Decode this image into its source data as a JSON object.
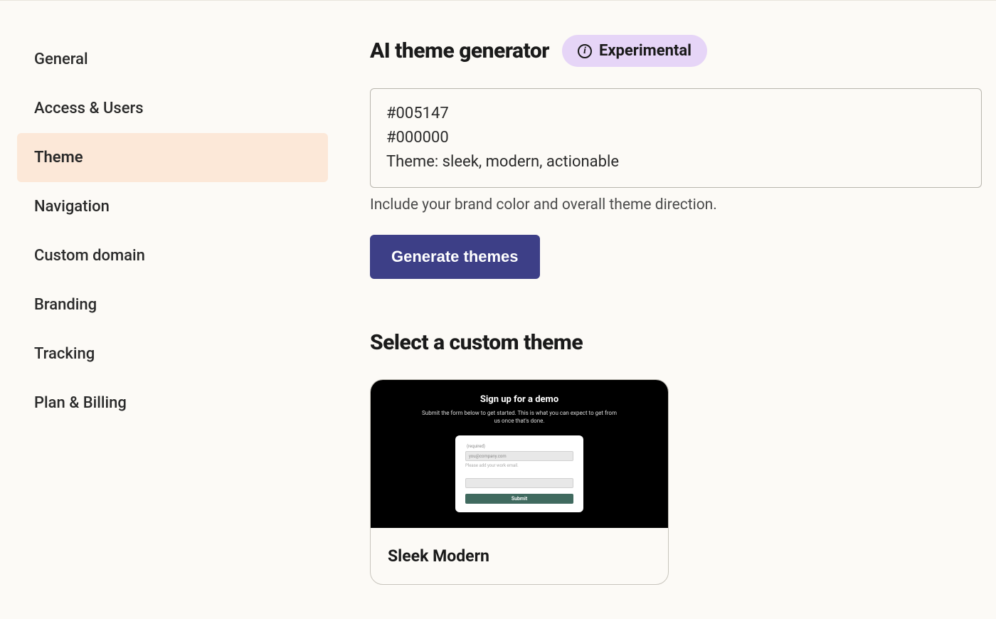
{
  "sidebar": {
    "items": [
      {
        "label": "General",
        "active": false
      },
      {
        "label": "Access & Users",
        "active": false
      },
      {
        "label": "Theme",
        "active": true
      },
      {
        "label": "Navigation",
        "active": false
      },
      {
        "label": "Custom domain",
        "active": false
      },
      {
        "label": "Branding",
        "active": false
      },
      {
        "label": "Tracking",
        "active": false
      },
      {
        "label": "Plan & Billing",
        "active": false
      }
    ]
  },
  "main": {
    "title": "AI theme generator",
    "badge_label": "Experimental",
    "prompt_value": "#005147\n#000000\nTheme: sleek, modern, actionable",
    "helper_text": "Include your brand color and overall theme direction.",
    "generate_button": "Generate themes",
    "section_title": "Select a custom theme"
  },
  "theme_card": {
    "name": "Sleek Modern",
    "preview": {
      "title": "Sign up for a demo",
      "subtitle": "Submit the form below to get started. This is what you can expect to get from us once that's done.",
      "required_label": "(required)",
      "email_placeholder": "you@company.com",
      "email_hint": "Please add your work email.",
      "submit_label": "Submit"
    }
  },
  "colors": {
    "accent_primary": "#3d3f87",
    "badge_bg": "#e6d5f7",
    "sidebar_active_bg": "#fce8d8",
    "preview_submit_bg": "#406a5f"
  }
}
